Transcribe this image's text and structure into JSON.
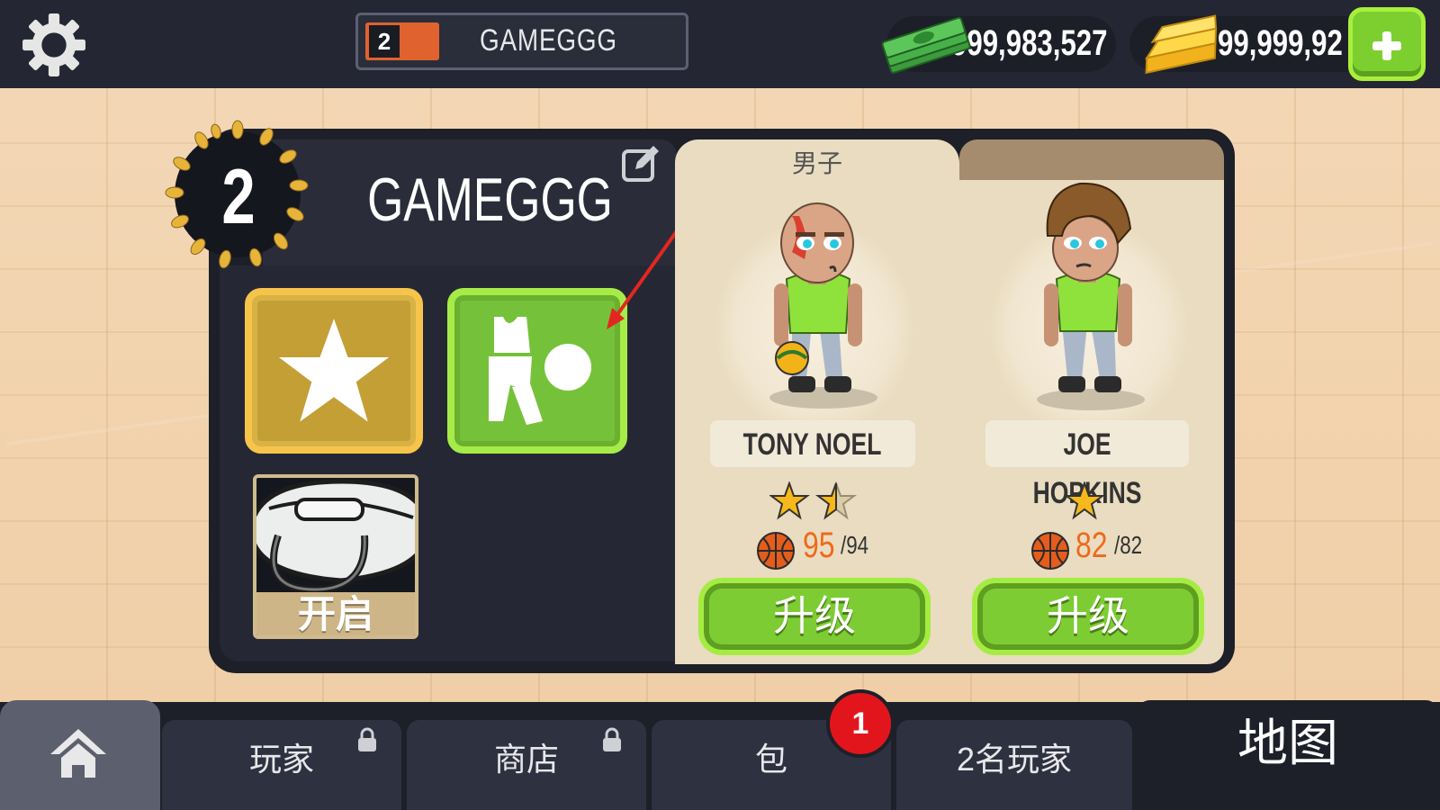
{
  "topbar": {
    "level": "2",
    "player_name": "GAMEGGG",
    "cash": "999,983,527",
    "gold": "99,999,92",
    "icons": [
      "gear-icon",
      "cash-icon",
      "gold-bar-icon",
      "plus-icon"
    ]
  },
  "profile": {
    "level": "2",
    "name": "GAMEGGG",
    "bag_label": "开启"
  },
  "roster": {
    "tab_active": "男子",
    "players": [
      {
        "name": "TONY NOEL",
        "stars": 1.5,
        "rating": "95",
        "rating_max": "/94",
        "button": "升级"
      },
      {
        "name": "JOE HOPKINS",
        "stars": 1,
        "rating": "82",
        "rating_max": "/82",
        "button": "升级"
      }
    ]
  },
  "nav": {
    "tabs": [
      "玩家",
      "商店",
      "包",
      "2名玩家"
    ],
    "map": "地图",
    "badge": "1"
  },
  "colors": {
    "topbar": "#242733",
    "panel": "#1d2029",
    "accent_green": "#7dcc34",
    "accent_gold": "#c49f35",
    "rating_orange": "#ee6a1c",
    "badge_red": "#e3151c"
  }
}
